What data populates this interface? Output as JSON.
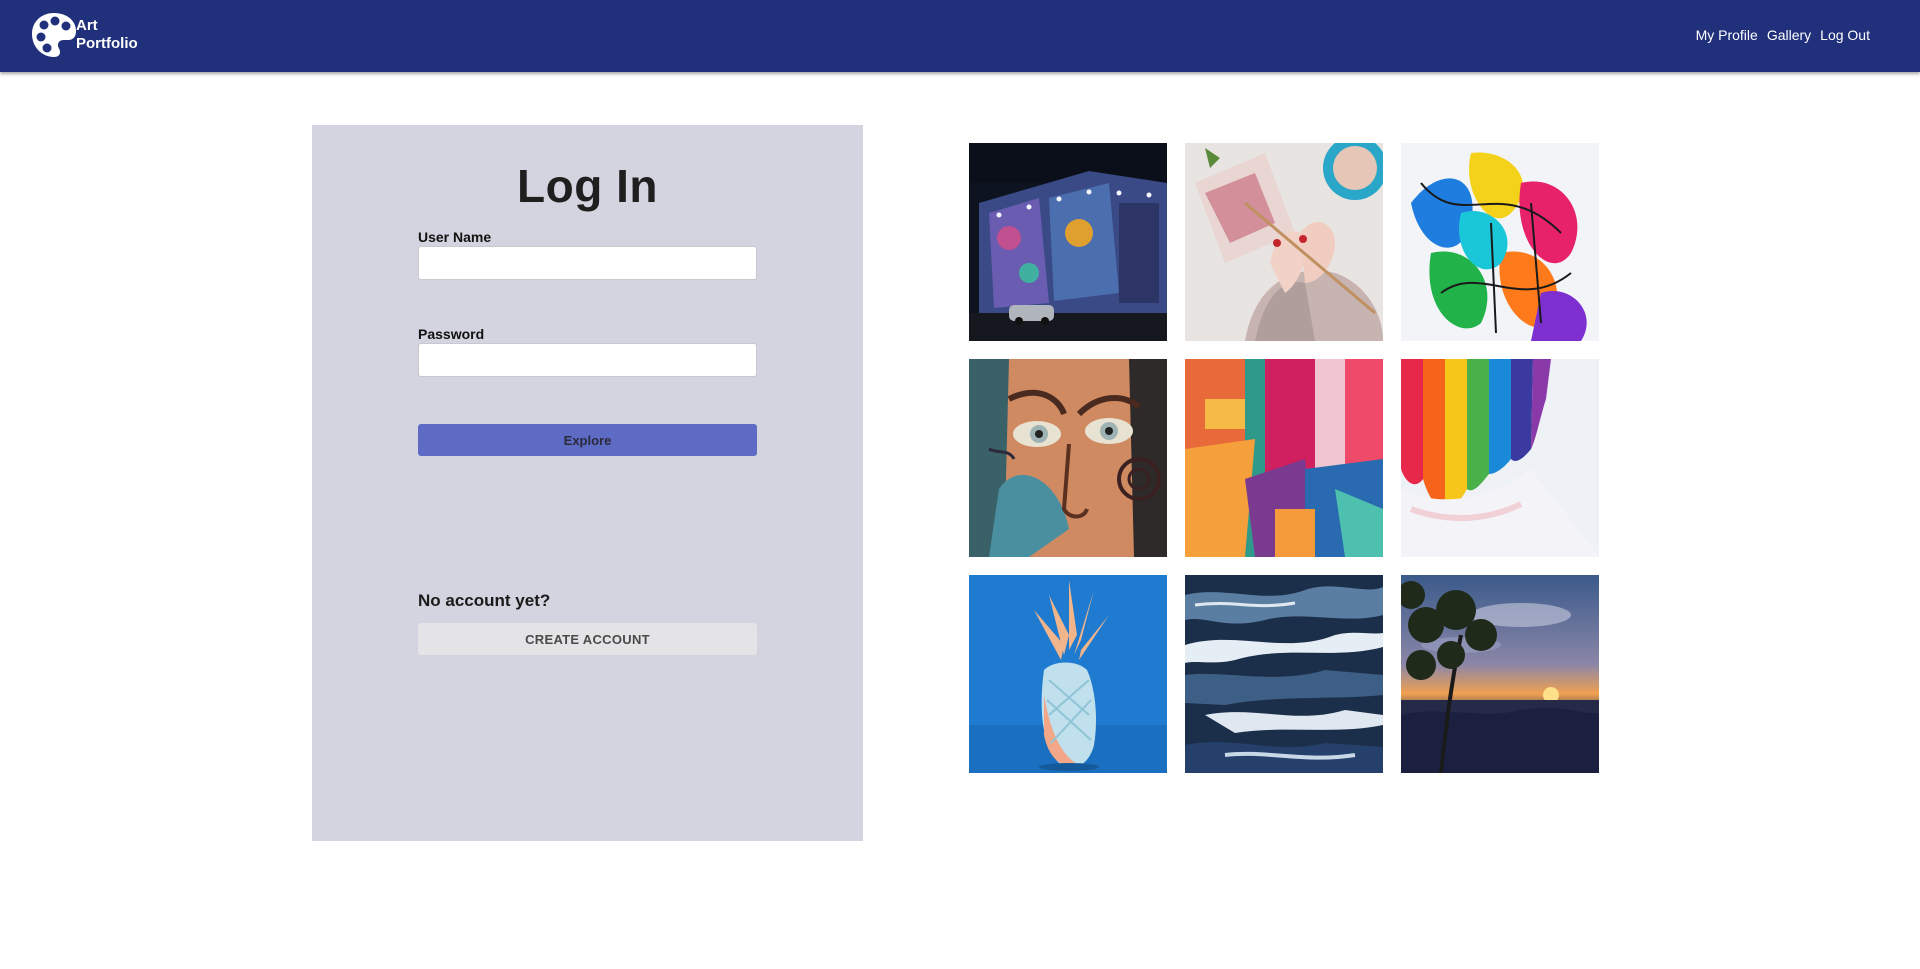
{
  "brand": {
    "line1": "Art",
    "line2": "Portfolio",
    "logo_icon": "palette-icon"
  },
  "nav": {
    "items": [
      {
        "label": "My Profile"
      },
      {
        "label": "Gallery"
      },
      {
        "label": "Log Out"
      }
    ]
  },
  "login": {
    "title": "Log In",
    "username_label": "User Name",
    "username_value": "",
    "password_label": "Password",
    "password_value": "",
    "submit_label": "Explore",
    "no_account_text": "No account yet?",
    "create_account_label": "CREATE ACCOUNT"
  },
  "colors": {
    "navbar": "#21307a",
    "panel": "#d3d4df",
    "primary_button": "#5e6bc5",
    "secondary_button": "#e4e4e6"
  },
  "gallery": {
    "images": [
      {
        "subject": "street-mural-building-at-night"
      },
      {
        "subject": "hands-knitting-with-coffee-cup"
      },
      {
        "subject": "colorful-abstract-paint-splashes"
      },
      {
        "subject": "face-mural-with-blue-eyes"
      },
      {
        "subject": "abstract-red-orange-painting"
      },
      {
        "subject": "rainbow-paint-strokes-on-white"
      },
      {
        "subject": "pastel-pineapple-sculpture-on-blue"
      },
      {
        "subject": "blue-white-wave-painting"
      },
      {
        "subject": "sunset-over-canyon-with-tree"
      }
    ]
  }
}
